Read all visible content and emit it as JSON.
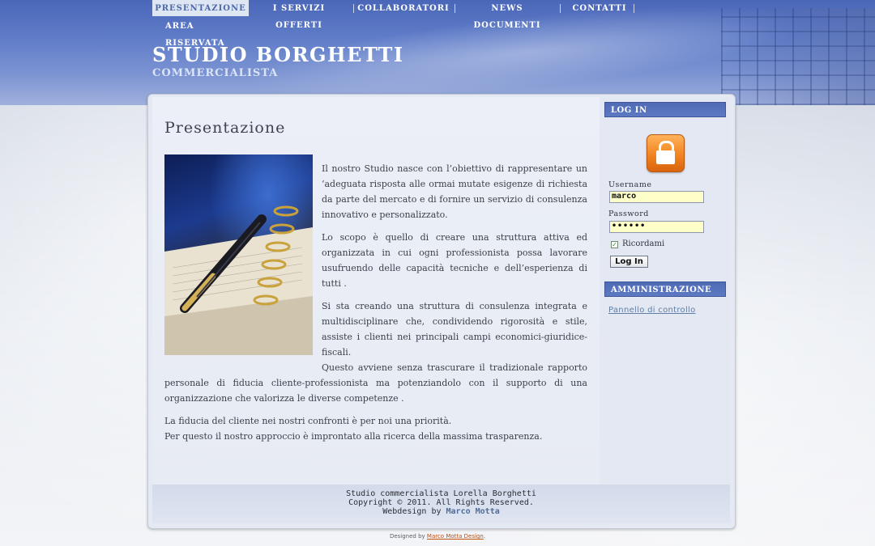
{
  "nav": {
    "items": [
      {
        "label": "PRESENTAZIONE",
        "active": true
      },
      {
        "label": "I SERVIZI OFFERTI"
      },
      {
        "label": "COLLABORATORI"
      },
      {
        "label": "NEWS DOCUMENTI"
      },
      {
        "label": "CONTATTI"
      },
      {
        "label": "AREA RISERVATA"
      }
    ]
  },
  "header": {
    "title": "STUDIO BORGHETTI",
    "subtitle": "COMMERCIALISTA"
  },
  "main": {
    "title": "Presentazione",
    "paragraphs": [
      "Il nostro Studio nasce con l’obiettivo di rappresentare un ‘adeguata risposta alle ormai mutate esigenze di richiesta da parte del mercato e di fornire un servizio di consulenza innovativo e personalizzato.",
      "Lo scopo è quello di creare una struttura attiva ed organizzata in cui ogni professionista possa lavorare usufruendo delle capacità tecniche e dell’esperienza di tutti .",
      "Si sta creando una struttura di consulenza integrata e multidisciplinare che, condividendo rigorosità e stile, assiste i clienti nei principali campi economici-giuridice-fiscali.",
      "Questo avviene senza trascurare il tradizionale rapporto personale di fiducia cliente-professionista ma potenziandolo con il supporto di una organizzazione che valorizza le diverse competenze .",
      "La fiducia del cliente nei nostri confronti è per noi una priorità.",
      "Per questo il nostro approccio è improntato alla ricerca della massima trasparenza."
    ]
  },
  "login": {
    "heading": "LOG IN",
    "username_label": "Username",
    "username_value": "marco",
    "password_label": "Password",
    "password_value": "••••••",
    "remember_label": "Ricordami",
    "remember_checked": true,
    "button_label": "Log In"
  },
  "admin": {
    "heading": "AMMINISTRAZIONE",
    "link": "Pannello di controllo"
  },
  "footer": {
    "line1": "Studio commercialista Lorella Borghetti",
    "line2": "Copyright © 2011. All Rights Reserved.",
    "webdesign_prefix": "Webdesign by",
    "webdesign_name": "Marco Motta"
  },
  "credit": {
    "prefix": "Designed by",
    "link": "Marco Motta Design",
    "suffix": "."
  },
  "colors": {
    "accent": "#4f6bb6",
    "input_bg": "#fefec8",
    "lock_orange": "#f0801c"
  }
}
